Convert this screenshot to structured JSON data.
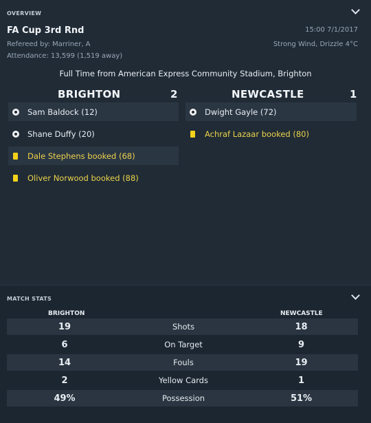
{
  "overview": {
    "section_title": "OVERVIEW",
    "competition": "FA Cup 3rd Rnd",
    "referee": "Refereed by: Marriner, A",
    "attendance": "Attendance: 13,599 (1,519 away)",
    "datetime": "15:00 7/1/2017",
    "weather": "Strong Wind, Drizzle 4°C",
    "headline": "Full Time from American Express Community Stadium, Brighton",
    "home": {
      "name": "BRIGHTON",
      "score": "2",
      "events": [
        {
          "type": "goal-ball-icon",
          "text": "Sam Baldock (12)",
          "booked": false
        },
        {
          "type": "goal-ball-icon",
          "text": "Shane Duffy (20)",
          "booked": false
        },
        {
          "type": "yellow-card-icon",
          "text": "Dale Stephens booked (68)",
          "booked": true
        },
        {
          "type": "yellow-card-icon",
          "text": "Oliver Norwood booked (88)",
          "booked": true
        }
      ]
    },
    "away": {
      "name": "NEWCASTLE",
      "score": "1",
      "events": [
        {
          "type": "goal-ball-icon",
          "text": "Dwight Gayle (72)",
          "booked": false
        },
        {
          "type": "yellow-card-icon",
          "text": "Achraf Lazaar booked (80)",
          "booked": true
        }
      ]
    }
  },
  "stats": {
    "section_title": "MATCH STATS",
    "home_label": "BRIGHTON",
    "away_label": "NEWCASTLE",
    "rows": [
      {
        "label": "Shots",
        "home": "19",
        "away": "18"
      },
      {
        "label": "On Target",
        "home": "6",
        "away": "9"
      },
      {
        "label": "Fouls",
        "home": "14",
        "away": "19"
      },
      {
        "label": "Yellow Cards",
        "home": "2",
        "away": "1"
      },
      {
        "label": "Possession",
        "home": "49%",
        "away": "51%"
      }
    ]
  },
  "colors": {
    "background": "#202b36",
    "highlight_row": "#2b3643",
    "yellow_card": "#f2d31a",
    "booked_text": "#ecd34a"
  }
}
